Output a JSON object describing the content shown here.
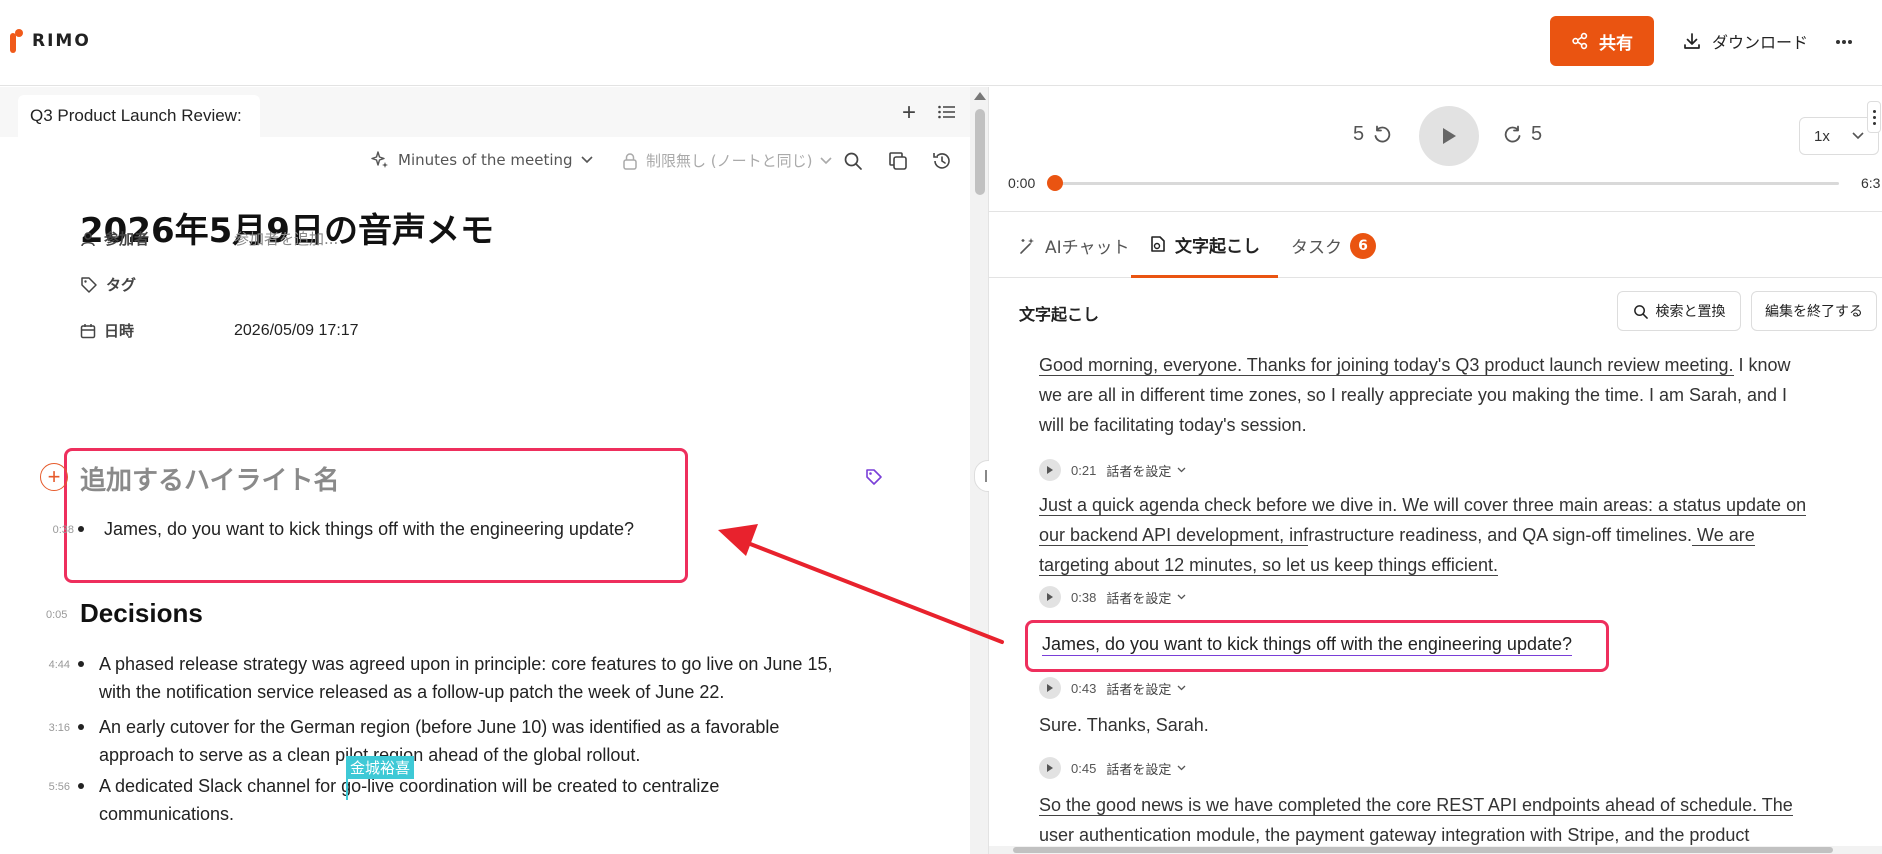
{
  "app": {
    "logo_text": "RIMO",
    "brand_color": "#ea5411",
    "highlight_color": "#ee2f5d"
  },
  "topbar": {
    "share_label": "共有",
    "download_label": "ダウンロード",
    "more_label": "···"
  },
  "left": {
    "tab_title": "Q3 Product Launch Review:",
    "toolbar": {
      "template_label": "Minutes of the meeting",
      "permission_label": "制限無し (ノートと同じ)"
    },
    "note_title": "2026年5月9日の音声メモ",
    "props": {
      "participants_label": "参加者",
      "participants_placeholder": "参加者を追加...",
      "tags_label": "タグ",
      "date_label": "日時",
      "date_value": "2026/05/09 17:17"
    },
    "highlight": {
      "title": "追加するハイライト名",
      "items": [
        {
          "ts": "0:38",
          "text": "James, do you want to kick things off with the engineering update?"
        }
      ]
    },
    "decisions": {
      "ts": "0:05",
      "title": "Decisions",
      "items": [
        {
          "ts": "4:44",
          "line1": "A phased release strategy was agreed upon in principle: core features to go live on June 15,",
          "line2": "with the notification service released as a follow-up patch the week of June 22."
        },
        {
          "ts": "3:16",
          "line1": "An early cutover for the German region (before June 10) was identified as a favorable",
          "line2": "approach to serve as a clean pilot region ahead of the global rollout."
        },
        {
          "ts": "5:56",
          "line1": "A dedicated Slack channel for go-live coordination will be created to centralize",
          "line2": "communications."
        }
      ]
    },
    "cursor_name_tag": "金城裕喜"
  },
  "player": {
    "skip_back": "5",
    "skip_forward": "5",
    "speed": "1x",
    "time_start": "0:00",
    "time_end": "6:3",
    "progress_fraction": 0.0
  },
  "right_tabs": {
    "ai_chat": "AIチャット",
    "transcript": "文字起こし",
    "tasks": "タスク",
    "tasks_count": "6"
  },
  "transcript": {
    "header": "文字起こし",
    "search_replace_label": "検索と置換",
    "finish_edit_label": "編集を終了する",
    "speaker_label": "話者を設定",
    "p1": {
      "l1a": "Good morning, everyone. Thanks for joining today's Q3 product launch review meeting.",
      "l1b": " I know",
      "l2": "we are all in different time zones, so I really appreciate you making the time. I am Sarah, and I",
      "l3": "will be facilitating today's session."
    },
    "seg2": {
      "ts": "0:21",
      "l1a": "Just a quick agenda check before we dive in.",
      "l1b": " We will cover three main areas: a status update on",
      "l2a": "our backend API development, inf",
      "l2b": "rastructure readiness, and QA sign-off timelines.",
      "l2c": " We are",
      "l3": "targeting about 12 minutes, so let us keep things efficient."
    },
    "seg3": {
      "ts": "0:38",
      "text": "James, do you want to kick things off with the engineering update?"
    },
    "seg4": {
      "ts": "0:43",
      "text": "Sure. Thanks, Sarah."
    },
    "seg5": {
      "ts": "0:45",
      "l1": "So the good news is we have completed the core REST API endpoints ahead of schedule. The",
      "l2": "user authentication module, the payment gateway integration with Stripe, and the product"
    }
  }
}
